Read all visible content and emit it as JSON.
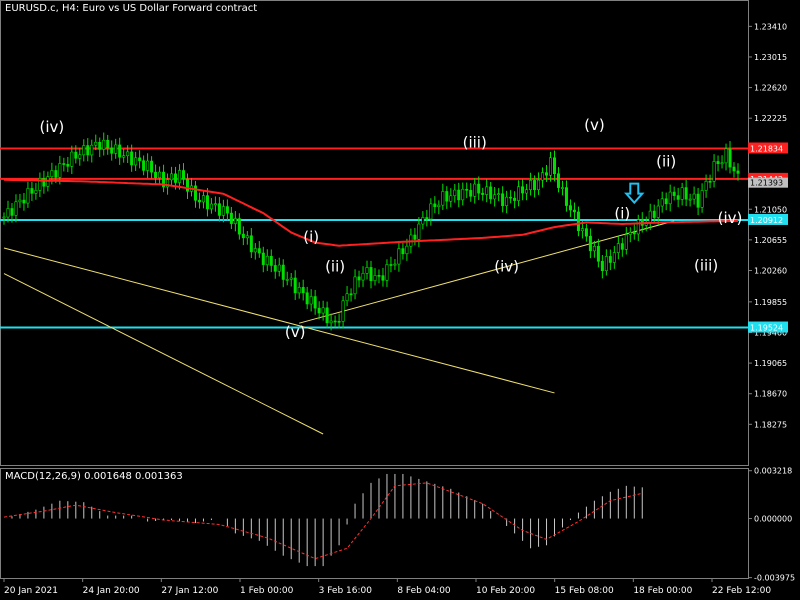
{
  "window": {
    "title": "EURUSD.c, H4:  Euro vs US Dollar Forward contract",
    "macd_label": "MACD(12,26,9) 0.001648 0.001363"
  },
  "chart_data": {
    "type": "candlestick",
    "symbol": "EURUSD.c",
    "timeframe": "H4",
    "ylim": [
      1.1775,
      1.2375
    ],
    "y_ticks": [
      "1.23410",
      "1.23015",
      "1.22620",
      "1.22225",
      "1.21830",
      "1.21445",
      "1.21050",
      "1.20655",
      "1.20260",
      "1.19855",
      "1.19460",
      "1.19065",
      "1.18670",
      "1.18275"
    ],
    "x_ticks": [
      "20 Jan 2021",
      "24 Jan 20:00",
      "27 Jan 12:00",
      "1 Feb 00:00",
      "3 Feb 16:00",
      "8 Feb 04:00",
      "10 Feb 20:00",
      "15 Feb 08:00",
      "18 Feb 00:00",
      "22 Feb 12:00"
    ],
    "price_path": [
      [
        0,
        1.2095
      ],
      [
        5,
        1.212
      ],
      [
        12,
        1.215
      ],
      [
        18,
        1.2175
      ],
      [
        24,
        1.219
      ],
      [
        28,
        1.218
      ],
      [
        32,
        1.217
      ],
      [
        36,
        1.216
      ],
      [
        40,
        1.214
      ],
      [
        44,
        1.215
      ],
      [
        48,
        1.212
      ],
      [
        52,
        1.211
      ],
      [
        56,
        1.21
      ],
      [
        60,
        1.207
      ],
      [
        64,
        1.2045
      ],
      [
        68,
        1.203
      ],
      [
        72,
        1.201
      ],
      [
        76,
        1.199
      ],
      [
        80,
        1.197
      ],
      [
        83,
        1.1955
      ],
      [
        86,
        1.1995
      ],
      [
        90,
        1.2025
      ],
      [
        94,
        1.2015
      ],
      [
        98,
        1.204
      ],
      [
        102,
        1.2065
      ],
      [
        106,
        1.21
      ],
      [
        110,
        1.212
      ],
      [
        114,
        1.2125
      ],
      [
        118,
        1.213
      ],
      [
        122,
        1.2125
      ],
      [
        126,
        1.2115
      ],
      [
        130,
        1.213
      ],
      [
        134,
        1.214
      ],
      [
        137,
        1.2165
      ],
      [
        140,
        1.2125
      ],
      [
        144,
        1.2085
      ],
      [
        148,
        1.205
      ],
      [
        150,
        1.203
      ],
      [
        154,
        1.2055
      ],
      [
        158,
        1.208
      ],
      [
        162,
        1.2095
      ],
      [
        166,
        1.212
      ],
      [
        170,
        1.2125
      ],
      [
        174,
        1.2115
      ],
      [
        178,
        1.216
      ],
      [
        181,
        1.2175
      ],
      [
        184,
        1.2145
      ]
    ],
    "moving_average": [
      [
        0,
        1.2143
      ],
      [
        20,
        1.2141
      ],
      [
        40,
        1.2137
      ],
      [
        55,
        1.2125
      ],
      [
        65,
        1.21
      ],
      [
        72,
        1.2075
      ],
      [
        78,
        1.2062
      ],
      [
        84,
        1.2058
      ],
      [
        100,
        1.2063
      ],
      [
        120,
        1.2068
      ],
      [
        130,
        1.2072
      ],
      [
        138,
        1.2082
      ],
      [
        146,
        1.2088
      ],
      [
        155,
        1.2086
      ],
      [
        165,
        1.2088
      ],
      [
        184,
        1.209
      ]
    ],
    "horizontal_lines": [
      {
        "price": 1.21834,
        "color": "#ff2020",
        "label": "1.21834"
      },
      {
        "price": 1.21442,
        "color": "#ff2020",
        "label": "1.21442"
      },
      {
        "price": 1.20912,
        "color": "#20e0f0",
        "label": "1.20912"
      },
      {
        "price": 1.19524,
        "color": "#20e0f0",
        "label": "1.19524"
      }
    ],
    "current_price_label": "1.21393",
    "trend_lines": [
      [
        [
          0,
          1.2055
        ],
        [
          138,
          1.1868
        ]
      ],
      [
        [
          0,
          1.2022
        ],
        [
          80,
          1.1815
        ]
      ],
      [
        [
          74,
          1.1958
        ],
        [
          168,
          1.209
        ]
      ]
    ],
    "wave_labels": [
      {
        "text": "(iv)",
        "x": 12,
        "price": 1.2205
      },
      {
        "text": "(v)",
        "x": 73,
        "price": 1.194
      },
      {
        "text": "(i)",
        "x": 77,
        "price": 1.2063
      },
      {
        "text": "(ii)",
        "x": 83,
        "price": 1.2025
      },
      {
        "text": "(iii)",
        "x": 118,
        "price": 1.2185
      },
      {
        "text": "(iv)",
        "x": 126,
        "price": 1.2025
      },
      {
        "text": "(v)",
        "x": 148,
        "price": 1.2207
      },
      {
        "text": "(ii)",
        "x": 166,
        "price": 1.216
      },
      {
        "text": "(i)",
        "x": 155,
        "price": 1.2093
      },
      {
        "text": "(iv)",
        "x": 182,
        "price": 1.2087
      },
      {
        "text": "(iii)",
        "x": 176,
        "price": 1.2026
      }
    ],
    "macd": {
      "ylim": [
        -0.004,
        0.0034
      ],
      "y_ticks": [
        "0.003218",
        "0.000000",
        "-0.003975"
      ],
      "histogram": [
        [
          0,
          0.0
        ],
        [
          8,
          0.0006
        ],
        [
          14,
          0.0012
        ],
        [
          20,
          0.0011
        ],
        [
          26,
          0.0002
        ],
        [
          32,
          0.0002
        ],
        [
          36,
          -0.0002
        ],
        [
          42,
          -0.0001
        ],
        [
          48,
          -0.0003
        ],
        [
          54,
          0.0
        ],
        [
          58,
          -0.001
        ],
        [
          64,
          -0.0015
        ],
        [
          70,
          -0.0025
        ],
        [
          76,
          -0.0032
        ],
        [
          80,
          -0.0032
        ],
        [
          84,
          -0.0018
        ],
        [
          88,
          0.001
        ],
        [
          92,
          0.0024
        ],
        [
          96,
          0.003
        ],
        [
          100,
          0.003
        ],
        [
          106,
          0.0025
        ],
        [
          112,
          0.002
        ],
        [
          116,
          0.0015
        ],
        [
          120,
          0.001
        ],
        [
          124,
          0.0
        ],
        [
          128,
          -0.001
        ],
        [
          132,
          -0.002
        ],
        [
          136,
          -0.0018
        ],
        [
          140,
          -0.0006
        ],
        [
          144,
          0.0004
        ],
        [
          148,
          0.0012
        ],
        [
          152,
          0.0018
        ],
        [
          156,
          0.0022
        ],
        [
          160,
          0.0021
        ]
      ],
      "signal": [
        [
          0,
          0.0001
        ],
        [
          10,
          0.0005
        ],
        [
          18,
          0.0009
        ],
        [
          28,
          0.0004
        ],
        [
          40,
          -0.0001
        ],
        [
          54,
          -0.0004
        ],
        [
          66,
          -0.0013
        ],
        [
          78,
          -0.0027
        ],
        [
          86,
          -0.002
        ],
        [
          92,
          0.0
        ],
        [
          98,
          0.0022
        ],
        [
          106,
          0.0024
        ],
        [
          120,
          0.001
        ],
        [
          130,
          -0.0008
        ],
        [
          136,
          -0.0014
        ],
        [
          144,
          -0.0002
        ],
        [
          152,
          0.0012
        ],
        [
          160,
          0.0017
        ]
      ]
    },
    "colors": {
      "background": "#000000",
      "up": "#00e000",
      "down": "#00e000",
      "ma": "#ff2020",
      "grid": "#2a2a2a",
      "text": "#ffffff",
      "trend": "#f0e070",
      "macd_hist": "#c8c8c8",
      "macd_signal": "#ff3030",
      "arrow": "#20c0f0",
      "current_bg": "#c0c0c0"
    }
  }
}
